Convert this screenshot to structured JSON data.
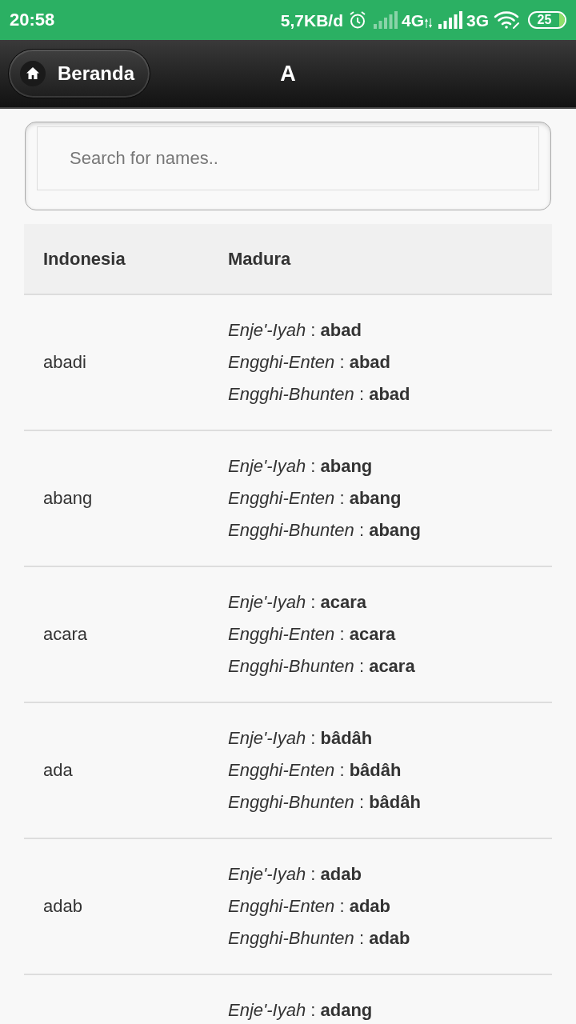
{
  "status_bar": {
    "time": "20:58",
    "network_speed": "5,7KB/d",
    "networks": [
      {
        "label": "4G",
        "signal_dimmed": true,
        "data_active": true
      },
      {
        "label": "3G",
        "signal_dimmed": false,
        "data_active": false
      }
    ],
    "battery": "25"
  },
  "header": {
    "back_button": "Beranda",
    "title": "A"
  },
  "search": {
    "placeholder": "Search for names.."
  },
  "table": {
    "columns": [
      "Indonesia",
      "Madura"
    ],
    "rows": [
      {
        "indonesia": "abadi",
        "madura": [
          "*Enje'-Iyah* : **abad**",
          "*Engghi-Enten* : **abad**",
          "*Engghi-Bhunten* : **abad**"
        ]
      },
      {
        "indonesia": "abang",
        "madura": [
          "*Enje'-Iyah* : **abang**",
          "*Engghi-Enten* : **abang**",
          "*Engghi-Bhunten* : **abang**"
        ]
      },
      {
        "indonesia": "acara",
        "madura": [
          "*Enje'-Iyah* : **acara**",
          "*Engghi-Enten* : **acara**",
          "*Engghi-Bhunten* : **acara**"
        ]
      },
      {
        "indonesia": "ada",
        "madura": [
          "*Enje'-Iyah* : **bâdâh**",
          "*Engghi-Enten* : **bâdâh**",
          "*Engghi-Bhunten* : **bâdâh**"
        ]
      },
      {
        "indonesia": "adab",
        "madura": [
          "*Enje'-Iyah* : **adab**",
          "*Engghi-Enten* : **adab**",
          "*Engghi-Bhunten* : **adab**"
        ]
      },
      {
        "madura": [
          "*Enje'-Iyah* : **adang**"
        ]
      }
    ]
  }
}
